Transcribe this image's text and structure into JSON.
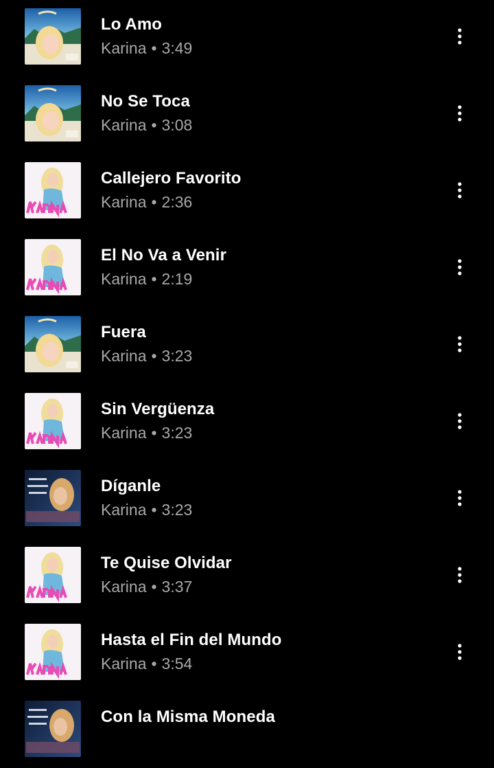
{
  "colors": {
    "background": "#000000",
    "title_text": "#ffffff",
    "meta_text": "#a9a9a9",
    "more_icon": "#ffffff",
    "cover_pink": "#e94bb5",
    "cover_sky": "#6fb7dc",
    "cover_dark": "#1a2f55"
  },
  "song_list": {
    "meta_separator": "•",
    "more_icon": "more-vert-icon",
    "items": [
      {
        "title": "Lo Amo",
        "artist": "Karina",
        "duration": "3:49",
        "cover": "cover-karina-beach"
      },
      {
        "title": "No Se Toca",
        "artist": "Karina",
        "duration": "3:08",
        "cover": "cover-karina-beach"
      },
      {
        "title": "Callejero Favorito",
        "artist": "Karina",
        "duration": "2:36",
        "cover": "cover-karina-pink"
      },
      {
        "title": "El No Va a Venir",
        "artist": "Karina",
        "duration": "2:19",
        "cover": "cover-karina-pink"
      },
      {
        "title": "Fuera",
        "artist": "Karina",
        "duration": "3:23",
        "cover": "cover-karina-beach"
      },
      {
        "title": "Sin Vergüenza",
        "artist": "Karina",
        "duration": "3:23",
        "cover": "cover-karina-pink"
      },
      {
        "title": "Díganle",
        "artist": "Karina",
        "duration": "3:23",
        "cover": "cover-karina-dark"
      },
      {
        "title": "Te Quise Olvidar",
        "artist": "Karina",
        "duration": "3:37",
        "cover": "cover-karina-pink"
      },
      {
        "title": "Hasta el Fin del Mundo",
        "artist": "Karina",
        "duration": "3:54",
        "cover": "cover-karina-pink"
      },
      {
        "title": "Con la Misma Moneda",
        "artist": "",
        "duration": "",
        "cover": "cover-karina-dark"
      }
    ]
  }
}
